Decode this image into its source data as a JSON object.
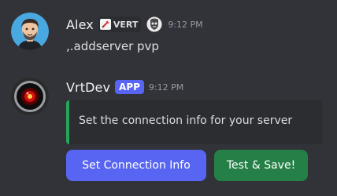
{
  "messages": [
    {
      "author": "Alex",
      "role_tag": "VERT",
      "guild_icon": "skull-emblem-icon",
      "timestamp": "9:12 PM",
      "content": ",.addserver pvp",
      "avatar": "user-avatar"
    },
    {
      "author": "VrtDev",
      "badge": "APP",
      "timestamp": "9:12 PM",
      "avatar": "red-eye-avatar",
      "embed": {
        "description": "Set the connection info for your server",
        "accent_color": "#23a55a"
      },
      "buttons": [
        {
          "label": "Set Connection Info",
          "style": "primary",
          "color": "#5865f2"
        },
        {
          "label": "Test & Save!",
          "style": "success",
          "color": "#248046"
        }
      ]
    }
  ],
  "theme": {
    "background": "#313338",
    "text": "#dbdee1",
    "username": "#f2f3f5",
    "timestamp": "#949ba4"
  }
}
